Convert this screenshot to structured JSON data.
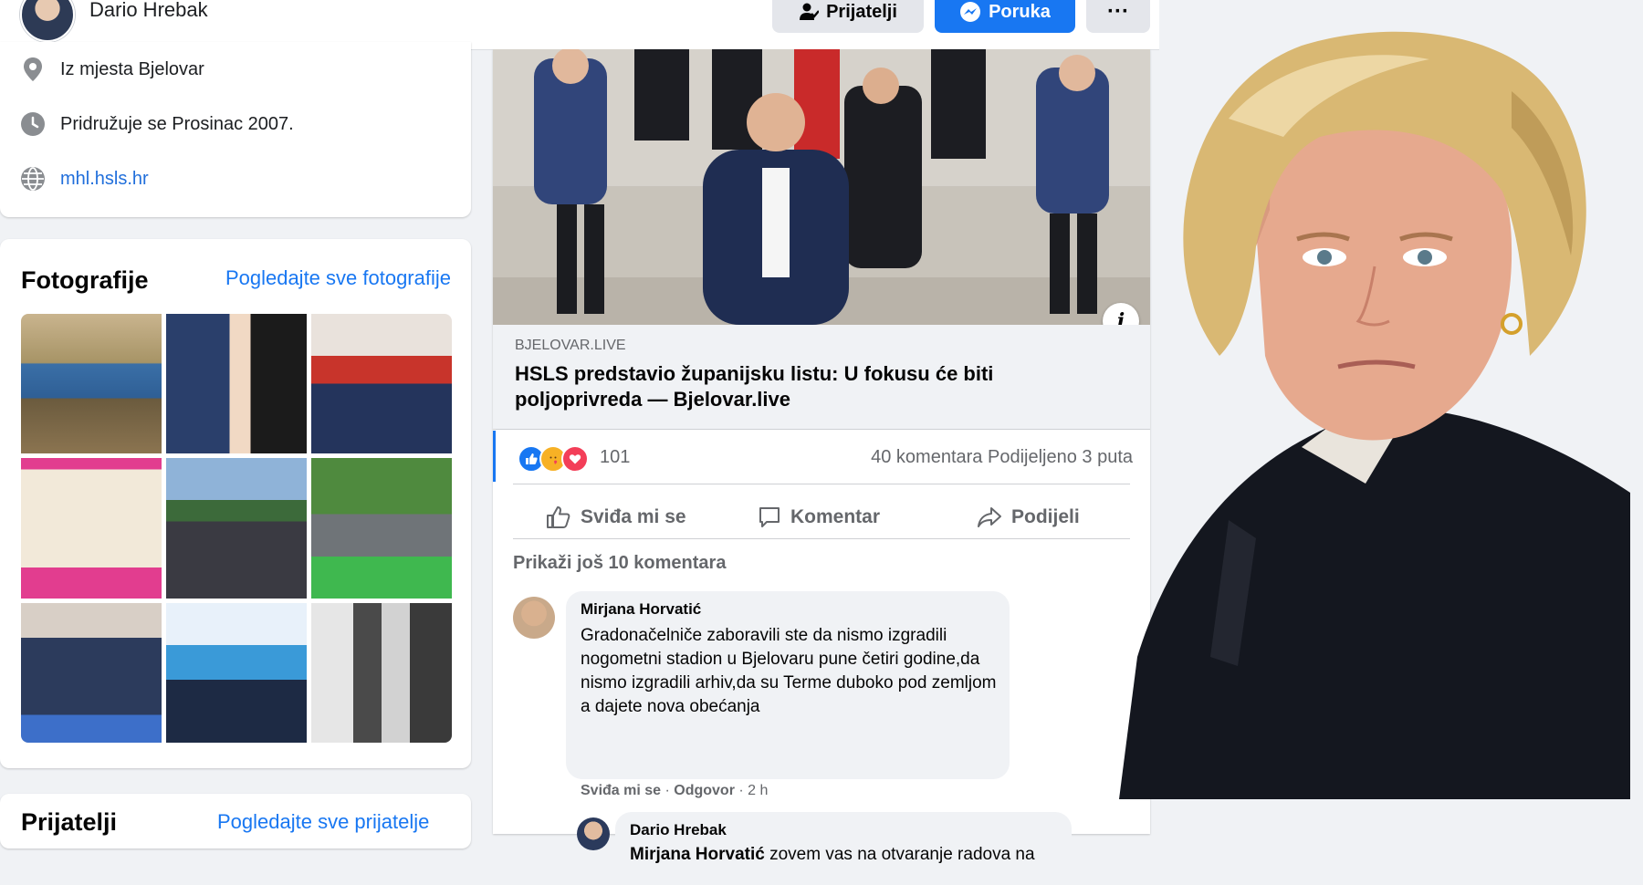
{
  "header": {
    "profile_name": "Dario Hrebak",
    "friends_button": "Prijatelji",
    "message_button": "Poruka",
    "more_button": "···"
  },
  "intro": {
    "location": "Iz mjesta Bjelovar",
    "joined": "Pridružuje se Prosinac 2007.",
    "website": "mhl.hsls.hr"
  },
  "photos": {
    "title": "Fotografije",
    "see_all": "Pogledajte sve fotografije"
  },
  "friends_section": {
    "title": "Prijatelji",
    "see_all": "Pogledajte sve prijatelje"
  },
  "post": {
    "link_domain": "BJELOVAR.LIVE",
    "link_title": "HSLS predstavio županijsku listu: U fokusu će biti poljoprivreda — Bjelovar.live",
    "reaction_count": "101",
    "comments_count": "40 komentara",
    "shares_count": "Podijeljeno 3 puta",
    "like_label": "Sviđa mi se",
    "comment_label": "Komentar",
    "share_label": "Podijeli",
    "more_comments": "Prikaži još 10 komentara"
  },
  "comments": [
    {
      "author": "Mirjana Horvatić",
      "text": "Gradonačelniče zaboravili ste da nismo izgradili nogometni stadion u Bjelovaru pune četiri godine,da nismo izgradili arhiv,da su Terme duboko pod zemljom a dajete nova obećanja",
      "like": "Sviđa mi se",
      "reply": "Odgovor",
      "time": "2 h"
    },
    {
      "author": "Dario Hrebak",
      "mention": "Mirjana Horvatić",
      "text": " zovem vas na otvaranje radova na"
    }
  ],
  "colors": {
    "brand_blue": "#1877f2",
    "background": "#f0f2f5",
    "secondary_text": "#65676b"
  }
}
